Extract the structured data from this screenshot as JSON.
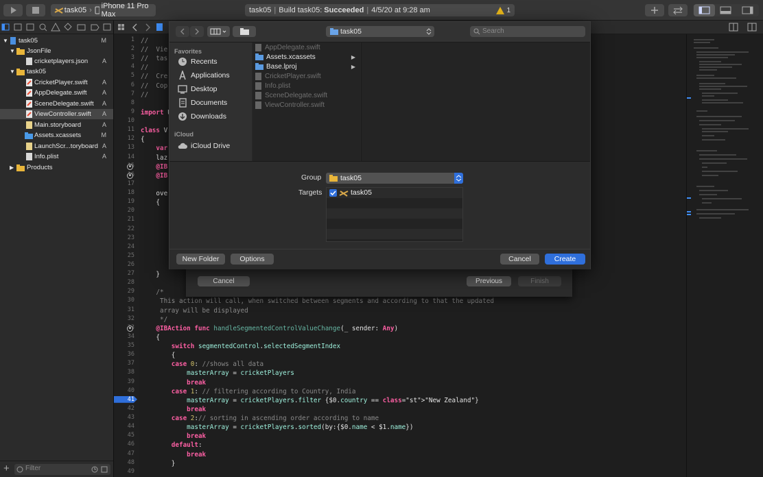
{
  "toolbar": {
    "scheme_name": "task05",
    "device_name": "iPhone 11 Pro Max",
    "activity_project": "task05",
    "activity_status_prefix": "Build task05:",
    "activity_status": "Succeeded",
    "activity_time": "4/5/20 at 9:28 am",
    "warning_count": "1"
  },
  "navigator": {
    "items": [
      {
        "label": "task05",
        "badge": "M"
      },
      {
        "label": "JsonFile",
        "badge": ""
      },
      {
        "label": "cricketplayers.json",
        "badge": "A"
      },
      {
        "label": "task05",
        "badge": ""
      },
      {
        "label": "CricketPlayer.swift",
        "badge": "A"
      },
      {
        "label": "AppDelegate.swift",
        "badge": "A"
      },
      {
        "label": "SceneDelegate.swift",
        "badge": "A"
      },
      {
        "label": "ViewController.swift",
        "badge": "A"
      },
      {
        "label": "Main.storyboard",
        "badge": "A"
      },
      {
        "label": "Assets.xcassets",
        "badge": "M"
      },
      {
        "label": "LaunchScr...toryboard",
        "badge": "A"
      },
      {
        "label": "Info.plist",
        "badge": "A"
      },
      {
        "label": "Products",
        "badge": ""
      }
    ],
    "filter_placeholder": "Filter"
  },
  "editor": {
    "current_line": "41",
    "lines": [
      {
        "n": "1",
        "t": "//"
      },
      {
        "n": "2",
        "t": "//  Vie"
      },
      {
        "n": "3",
        "t": "//  tas"
      },
      {
        "n": "4",
        "t": "//"
      },
      {
        "n": "5",
        "t": "//  Cre"
      },
      {
        "n": "6",
        "t": "//  Cop"
      },
      {
        "n": "7",
        "t": "//"
      },
      {
        "n": "8",
        "t": ""
      },
      {
        "n": "9",
        "t": "import U"
      },
      {
        "n": "10",
        "t": ""
      },
      {
        "n": "11",
        "t": "class V"
      },
      {
        "n": "12",
        "t": "{"
      },
      {
        "n": "13",
        "t": "    var"
      },
      {
        "n": "14",
        "t": "    laz"
      },
      {
        "n": "15",
        "t": "    @IB"
      },
      {
        "n": "16",
        "t": "    @IB"
      },
      {
        "n": "17",
        "t": ""
      },
      {
        "n": "18",
        "t": "    ove"
      },
      {
        "n": "19",
        "t": "    {"
      },
      {
        "n": "20",
        "t": ""
      },
      {
        "n": "21",
        "t": ""
      },
      {
        "n": "22",
        "t": ""
      },
      {
        "n": "23",
        "t": ""
      },
      {
        "n": "24",
        "t": ""
      },
      {
        "n": "25",
        "t": ""
      },
      {
        "n": "26",
        "t": ""
      },
      {
        "n": "27",
        "t": "    }"
      },
      {
        "n": "28",
        "t": ""
      },
      {
        "n": "29",
        "t": "    /*"
      },
      {
        "n": "30",
        "t": "     This action will call, when switched between segments and according to that the updated"
      },
      {
        "n": "31",
        "t": "     array will be displayed"
      },
      {
        "n": "32",
        "t": "     */"
      },
      {
        "n": "33",
        "t": "    @IBAction func handleSegmentedControlValueChange(_ sender: Any)"
      },
      {
        "n": "34",
        "t": "    {"
      },
      {
        "n": "35",
        "t": "        switch segmentedControl.selectedSegmentIndex"
      },
      {
        "n": "36",
        "t": "        {"
      },
      {
        "n": "37",
        "t": "        case 0: //shows all data"
      },
      {
        "n": "38",
        "t": "            masterArray = cricketPlayers"
      },
      {
        "n": "39",
        "t": "            break"
      },
      {
        "n": "40",
        "t": "        case 1: // filtering according to Country, India"
      },
      {
        "n": "41",
        "t": "            masterArray = cricketPlayers.filter {$0.country == \"New Zealand\"}"
      },
      {
        "n": "42",
        "t": "            break"
      },
      {
        "n": "43",
        "t": "        case 2:// sorting in ascending order according to name"
      },
      {
        "n": "44",
        "t": "            masterArray = cricketPlayers.sorted(by:{$0.name < $1.name})"
      },
      {
        "n": "45",
        "t": "            break"
      },
      {
        "n": "46",
        "t": "        default:"
      },
      {
        "n": "47",
        "t": "            break"
      },
      {
        "n": "48",
        "t": "        }"
      },
      {
        "n": "49",
        "t": ""
      }
    ]
  },
  "wizard": {
    "cancel": "Cancel",
    "previous": "Previous",
    "finish": "Finish"
  },
  "save_sheet": {
    "location": "task05",
    "search_placeholder": "Search",
    "favorites_header": "Favorites",
    "favorites": [
      "Recents",
      "Applications",
      "Desktop",
      "Documents",
      "Downloads"
    ],
    "icloud_header": "iCloud",
    "icloud_drive": "iCloud Drive",
    "files": [
      {
        "name": "AppDelegate.swift",
        "enabled": false
      },
      {
        "name": "Assets.xcassets",
        "enabled": true
      },
      {
        "name": "Base.lproj",
        "enabled": true
      },
      {
        "name": "CricketPlayer.swift",
        "enabled": false
      },
      {
        "name": "Info.plist",
        "enabled": false
      },
      {
        "name": "SceneDelegate.swift",
        "enabled": false
      },
      {
        "name": "ViewController.swift",
        "enabled": false
      }
    ],
    "group_label": "Group",
    "group_value": "task05",
    "targets_label": "Targets",
    "target_name": "task05",
    "new_folder": "New Folder",
    "options": "Options",
    "cancel": "Cancel",
    "create": "Create",
    "accent": "#2f6fdb"
  }
}
